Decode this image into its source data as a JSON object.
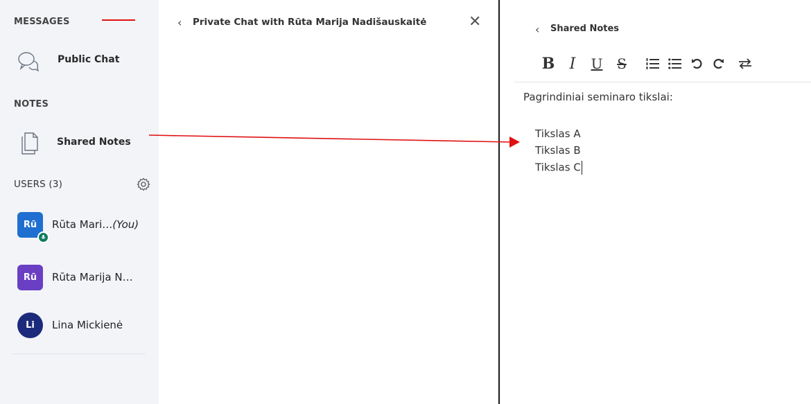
{
  "sidebar": {
    "messages_title": "MESSAGES",
    "public_chat_label": "Public Chat",
    "notes_title": "NOTES",
    "shared_notes_label": "Shared Notes",
    "users_title": "USERS (3)",
    "users": [
      {
        "initials": "Rū",
        "name": "Rūta Mari…",
        "suffix": "(You)",
        "color": "#1f6fd1"
      },
      {
        "initials": "Rū",
        "name": "Rūta Marija N…",
        "suffix": "",
        "color": "#6a3fc4"
      },
      {
        "initials": "Li",
        "name": "Lina Mickienė",
        "suffix": "",
        "color": "#1b2a7a"
      }
    ]
  },
  "chat": {
    "title": "Private Chat with Rūta Marija Nadišauskaitė"
  },
  "notes": {
    "title": "Shared Notes",
    "toolbar": {
      "bold": "B",
      "italic": "I",
      "underline": "U",
      "strike": "S"
    },
    "heading_line": "Pagrindiniai seminaro tikslai:",
    "items": [
      "Tikslas A",
      "Tikslas B",
      "Tikslas C"
    ]
  },
  "colors": {
    "annotation_red": "#e01010",
    "sidebar_bg": "#f2f4f8"
  }
}
